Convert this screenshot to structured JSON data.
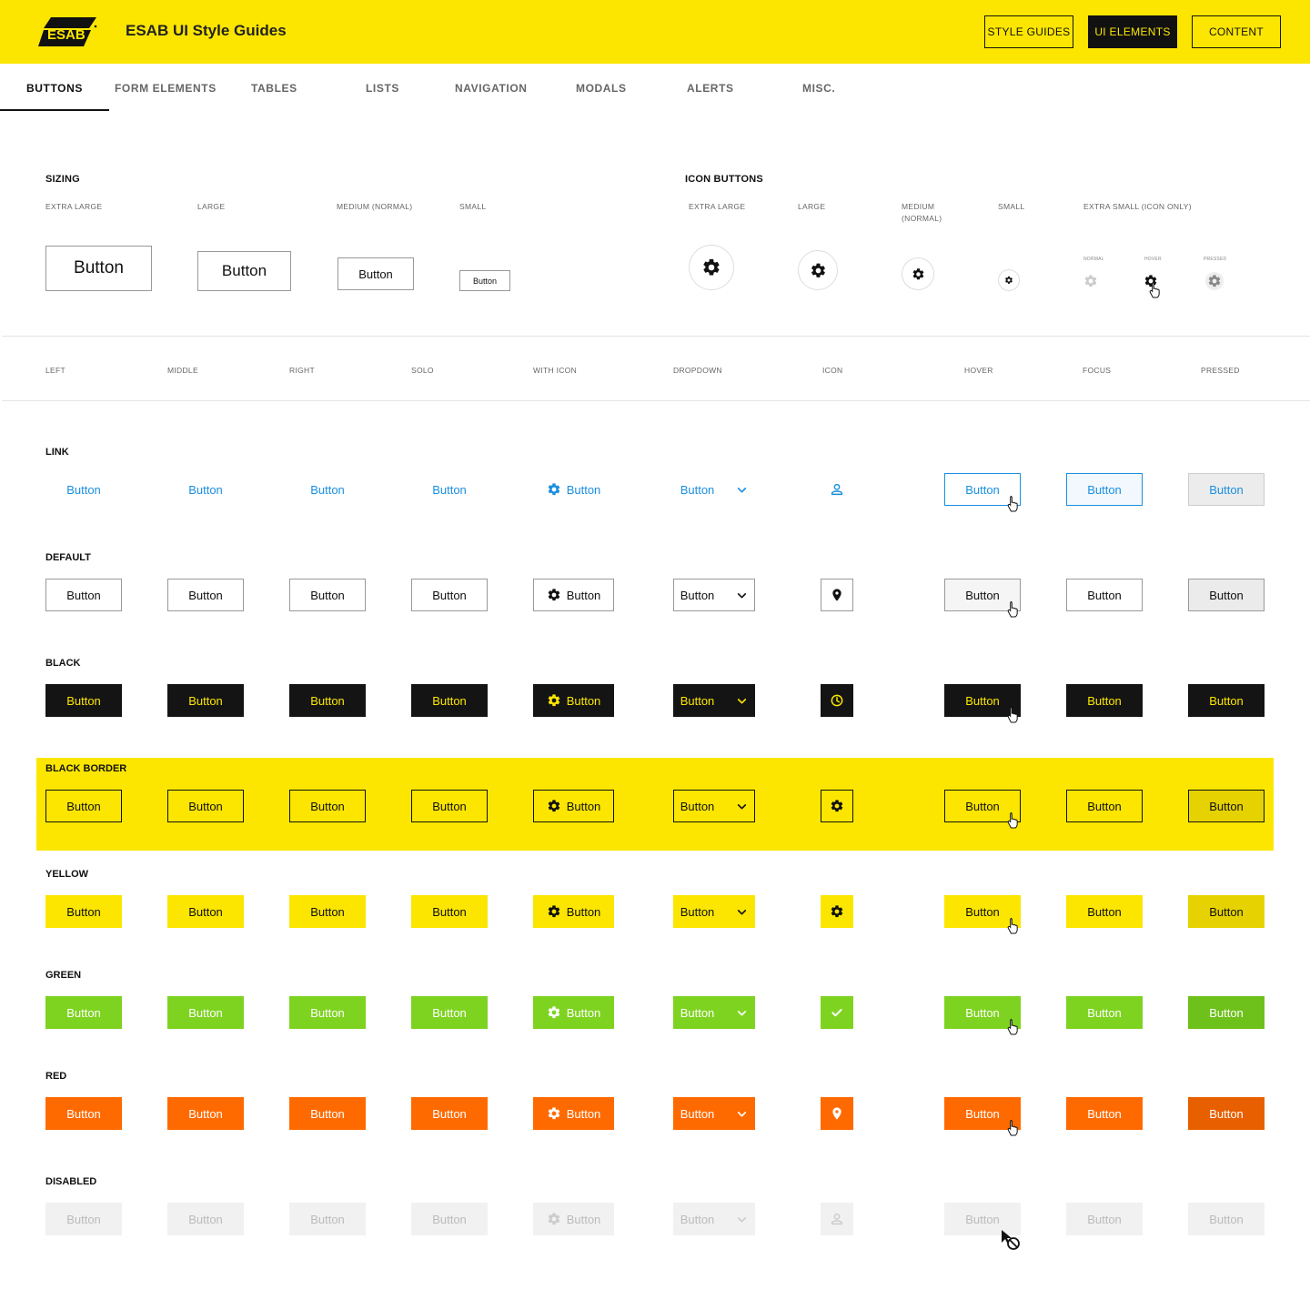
{
  "header": {
    "logo_text": "ESAB",
    "title": "ESAB UI Style Guides",
    "nav": [
      "STYLE GUIDES",
      "UI ELEMENTS",
      "CONTENT"
    ],
    "active_nav": "UI ELEMENTS",
    "brand_yellow": "#FCE600"
  },
  "tabs": [
    "BUTTONS",
    "FORM ELEMENTS",
    "TABLES",
    "LISTS",
    "NAVIGATION",
    "MODALS",
    "ALERTS",
    "MISC."
  ],
  "active_tab": "BUTTONS",
  "sizing": {
    "title": "SIZING",
    "labels": [
      "EXTRA LARGE",
      "LARGE",
      "MEDIUM (NORMAL)",
      "SMALL"
    ],
    "button_label": "Button"
  },
  "icon_buttons": {
    "title": "ICON BUTTONS",
    "labels": [
      "EXTRA LARGE",
      "LARGE",
      "MEDIUM",
      "(NORMAL)",
      "SMALL",
      "EXTRA SMALL (ICON ONLY)"
    ],
    "xs_states": [
      "NORMAL",
      "HOVER",
      "PRESSED"
    ],
    "icon": "gear-icon"
  },
  "columns": [
    "LEFT",
    "MIDDLE",
    "RIGHT",
    "SOLO",
    "WITH ICON",
    "DROPDOWN",
    "ICON",
    "HOVER",
    "FOCUS",
    "PRESSED"
  ],
  "button_label": "Button",
  "rows": [
    {
      "label": "LINK",
      "variant": "link",
      "icon": "user-icon"
    },
    {
      "label": "DEFAULT",
      "variant": "default",
      "icon": "location-pin-icon"
    },
    {
      "label": "BLACK",
      "variant": "black",
      "icon": "clock-icon"
    },
    {
      "label": "BLACK BORDER",
      "variant": "black-border",
      "icon": "gear-icon"
    },
    {
      "label": "YELLOW",
      "variant": "yellow",
      "icon": "gear-icon"
    },
    {
      "label": "GREEN",
      "variant": "green",
      "icon": "check-icon"
    },
    {
      "label": "RED",
      "variant": "red",
      "icon": "location-pin-icon"
    },
    {
      "label": "DISABLED",
      "variant": "disabled",
      "icon": "user-icon"
    }
  ],
  "colors": {
    "link": "#1A8FE0",
    "black": "#141414",
    "yellow": "#FCE600",
    "green": "#7ED321",
    "red": "#FF6A00",
    "disabled": "#F1F1F1"
  }
}
